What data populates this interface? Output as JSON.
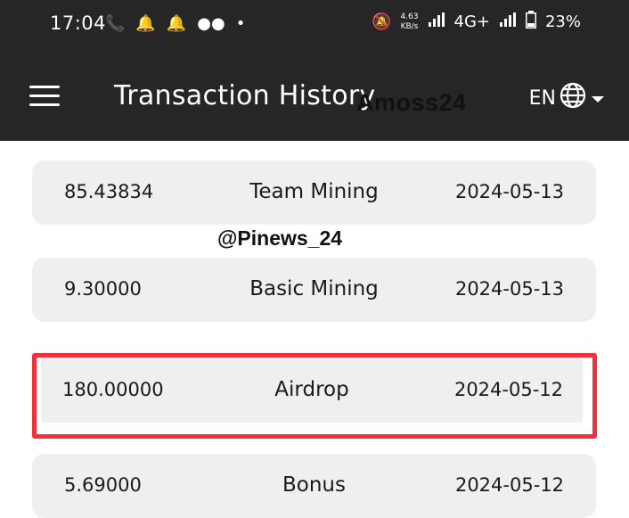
{
  "status_bar": {
    "time": "17:04",
    "net_speed_value": "4.63",
    "net_speed_unit": "KB/s",
    "network": "4G+",
    "battery": "23%"
  },
  "app_bar": {
    "title": "Transaction History",
    "language": "EN"
  },
  "watermarks": {
    "top": "Amoss24",
    "middle": "@Pinews_24"
  },
  "transactions": [
    {
      "amount": "85.43834",
      "type": "Team Mining",
      "date": "2024-05-13"
    },
    {
      "amount": "9.30000",
      "type": "Basic Mining",
      "date": "2024-05-13"
    },
    {
      "amount": "180.00000",
      "type": "Airdrop",
      "date": "2024-05-12"
    },
    {
      "amount": "5.69000",
      "type": "Bonus",
      "date": "2024-05-12"
    }
  ],
  "colors": {
    "bar_background": "#262626",
    "row_background": "#efefef",
    "highlight_border": "#f0303a"
  }
}
